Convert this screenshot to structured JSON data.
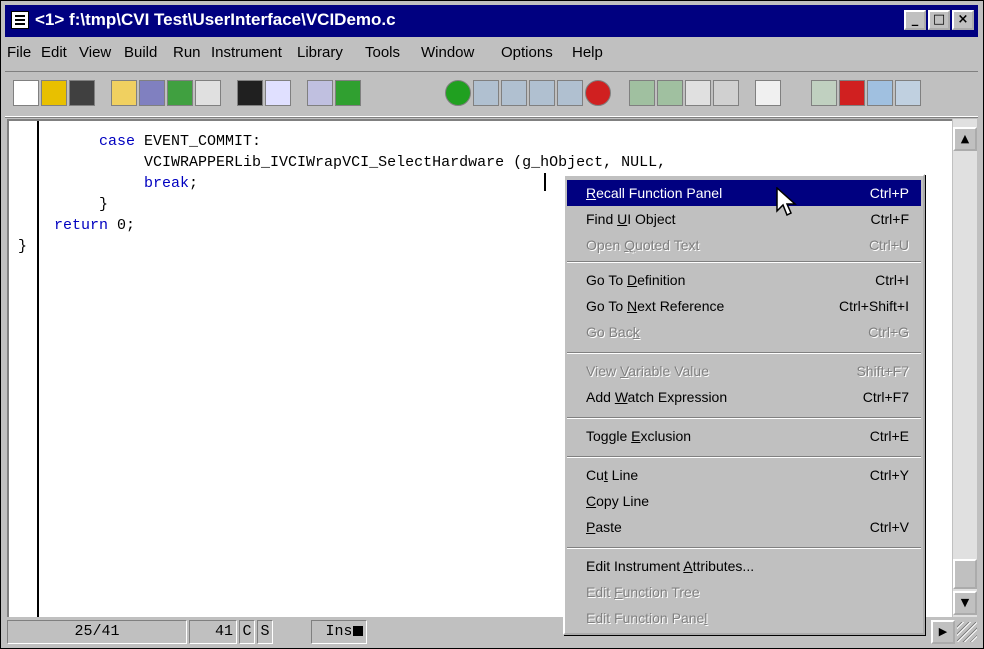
{
  "window": {
    "title": "<1> f:\\tmp\\CVI Test\\UserInterface\\VCIDemo.c",
    "controls": {
      "minimize": "_",
      "maximize": "□",
      "close": "×"
    }
  },
  "menubar": [
    "File",
    "Edit",
    "View",
    "Build",
    "Run",
    "Instrument",
    "Library",
    "Tools",
    "Window",
    "Options",
    "Help"
  ],
  "toolbar": {
    "icons": [
      "new-file-icon",
      "open-file-icon",
      "save-icon",
      "edit-icon",
      "include-icon",
      "recall-icon",
      "panel-icon",
      "find-icon",
      "replace-icon",
      "project-icon",
      "run-icon",
      "go-icon",
      "step-over-icon",
      "step-into-icon",
      "finish-icon",
      "breakpoint-icon",
      "stop-icon",
      "watch-icon",
      "variables-icon",
      "glasses-icon",
      "calc-icon",
      "document-icon",
      "toggle-icon",
      "exclude-icon",
      "link-icon",
      "page-icon"
    ]
  },
  "code": {
    "lines": [
      {
        "indent": "          ",
        "kw": "case",
        "text": " EVENT_COMMIT:"
      },
      {
        "indent": "               ",
        "kw": "",
        "text": "VCIWRAPPERLib_IVCIWrapVCI_SelectHardware (g_hObject, NULL,"
      },
      {
        "indent": "",
        "kw": "",
        "text": ""
      },
      {
        "indent": "",
        "kw": "",
        "text": ""
      },
      {
        "indent": "               ",
        "kw": "break",
        "text": ";"
      },
      {
        "indent": "          ",
        "kw": "",
        "text": "}"
      },
      {
        "indent": "     ",
        "kw": "return",
        "text": " 0;"
      },
      {
        "indent": " ",
        "kw": "",
        "text": "}"
      }
    ]
  },
  "status": {
    "line_pos": "25/41",
    "col": "41",
    "flag_c": "C",
    "flag_s": "S",
    "mode": "Ins"
  },
  "context_menu": {
    "items": [
      {
        "pre": "",
        "u": "R",
        "post": "ecall Function Panel",
        "shortcut": "Ctrl+P",
        "state": "highlighted"
      },
      {
        "pre": "Find ",
        "u": "U",
        "post": "I Object",
        "shortcut": "Ctrl+F",
        "state": "enabled"
      },
      {
        "pre": "Open ",
        "u": "Q",
        "post": "uoted Text",
        "shortcut": "Ctrl+U",
        "state": "disabled"
      },
      {
        "pre": "Go To ",
        "u": "D",
        "post": "efinition",
        "shortcut": "Ctrl+I",
        "state": "enabled"
      },
      {
        "pre": "Go To ",
        "u": "N",
        "post": "ext Reference",
        "shortcut": "Ctrl+Shift+I",
        "state": "enabled"
      },
      {
        "pre": "Go Bac",
        "u": "k",
        "post": "",
        "shortcut": "Ctrl+G",
        "state": "disabled"
      },
      {
        "pre": "View ",
        "u": "V",
        "post": "ariable Value",
        "shortcut": "Shift+F7",
        "state": "disabled"
      },
      {
        "pre": "Add ",
        "u": "W",
        "post": "atch Expression",
        "shortcut": "Ctrl+F7",
        "state": "enabled"
      },
      {
        "pre": "Toggle ",
        "u": "E",
        "post": "xclusion",
        "shortcut": "Ctrl+E",
        "state": "enabled"
      },
      {
        "pre": "Cu",
        "u": "t",
        "post": " Line",
        "shortcut": "Ctrl+Y",
        "state": "enabled"
      },
      {
        "pre": "",
        "u": "C",
        "post": "opy Line",
        "shortcut": "",
        "state": "enabled"
      },
      {
        "pre": "",
        "u": "P",
        "post": "aste",
        "shortcut": "Ctrl+V",
        "state": "enabled"
      },
      {
        "pre": "Edit Instrument ",
        "u": "A",
        "post": "ttributes...",
        "shortcut": "",
        "state": "enabled"
      },
      {
        "pre": "Edit ",
        "u": "F",
        "post": "unction Tree",
        "shortcut": "",
        "state": "disabled"
      },
      {
        "pre": "Edit Function Pane",
        "u": "l",
        "post": "",
        "shortcut": "",
        "state": "disabled"
      }
    ]
  },
  "colors": {
    "titlebar": "#000080",
    "face": "#c0c0c0",
    "keyword": "#0000c0",
    "highlight": "#000080",
    "disabled": "#808080"
  }
}
